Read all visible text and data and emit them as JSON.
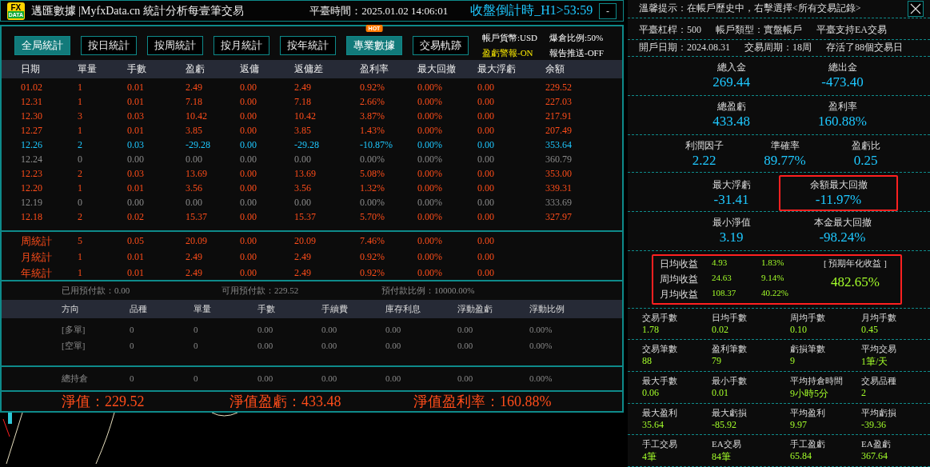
{
  "header": {
    "logo": [
      "FX",
      "DATA"
    ],
    "title": "邁匯數據 |MyfxData.cn 統計分析每壹筆交易",
    "time": "平臺時間：2025.01.02 14:06:01",
    "countdown": "收盤倒計時_H1>53:59",
    "minimize": "-"
  },
  "tabs": [
    {
      "label": "全局統計",
      "selected": true
    },
    {
      "label": "按日統計",
      "selected": false
    },
    {
      "label": "按周統計",
      "selected": false
    },
    {
      "label": "按月統計",
      "selected": false
    },
    {
      "label": "按年統計",
      "selected": false
    },
    {
      "label": "專業數據",
      "selected": true,
      "badge": "HOT"
    },
    {
      "label": "交易軌跡",
      "selected": false
    }
  ],
  "account_info": [
    {
      "text": "帳戶貨幣:USD",
      "kind": "plain"
    },
    {
      "text": "爆倉比例:50%",
      "kind": "plain"
    },
    {
      "text": "盈虧警報-ON",
      "kind": "alert"
    },
    {
      "text": "報告推送-OFF",
      "kind": "plain"
    }
  ],
  "table": {
    "columns": [
      "日期",
      "單量",
      "手數",
      "盈虧",
      "返傭",
      "返傭差",
      "盈利率",
      "最大回撤",
      "最大浮虧",
      "余額"
    ],
    "rows": [
      {
        "color": "#ff4d1a",
        "cells": [
          "01.02",
          "1",
          "0.01",
          "2.49",
          "0.00",
          "2.49",
          "0.92%",
          "0.00%",
          "0.00",
          "229.52"
        ]
      },
      {
        "color": "#ff4d1a",
        "cells": [
          "12.31",
          "1",
          "0.01",
          "7.18",
          "0.00",
          "7.18",
          "2.66%",
          "0.00%",
          "0.00",
          "227.03"
        ]
      },
      {
        "color": "#ff4d1a",
        "cells": [
          "12.30",
          "3",
          "0.03",
          "10.42",
          "0.00",
          "10.42",
          "3.87%",
          "0.00%",
          "0.00",
          "217.91"
        ]
      },
      {
        "color": "#ff4d1a",
        "cells": [
          "12.27",
          "1",
          "0.01",
          "3.85",
          "0.00",
          "3.85",
          "1.43%",
          "0.00%",
          "0.00",
          "207.49"
        ]
      },
      {
        "color": "#1ec8ff",
        "cells": [
          "12.26",
          "2",
          "0.03",
          "-29.28",
          "0.00",
          "-29.28",
          "-10.87%",
          "0.00%",
          "0.00",
          "353.64"
        ]
      },
      {
        "color": "#8a8a8a",
        "cells": [
          "12.24",
          "0",
          "0.00",
          "0.00",
          "0.00",
          "0.00",
          "0.00%",
          "0.00%",
          "0.00",
          "360.79"
        ]
      },
      {
        "color": "#ff4d1a",
        "cells": [
          "12.23",
          "2",
          "0.03",
          "13.69",
          "0.00",
          "13.69",
          "5.08%",
          "0.00%",
          "0.00",
          "353.00"
        ]
      },
      {
        "color": "#ff4d1a",
        "cells": [
          "12.20",
          "1",
          "0.01",
          "3.56",
          "0.00",
          "3.56",
          "1.32%",
          "0.00%",
          "0.00",
          "339.31"
        ]
      },
      {
        "color": "#8a8a8a",
        "cells": [
          "12.19",
          "0",
          "0.00",
          "0.00",
          "0.00",
          "0.00",
          "0.00%",
          "0.00%",
          "0.00",
          "333.69"
        ]
      },
      {
        "color": "#ff4d1a",
        "cells": [
          "12.18",
          "2",
          "0.02",
          "15.37",
          "0.00",
          "15.37",
          "5.70%",
          "0.00%",
          "0.00",
          "327.97"
        ]
      }
    ],
    "summary": [
      [
        "周統計",
        "5",
        "0.05",
        "20.09",
        "0.00",
        "20.09",
        "7.46%",
        "0.00%",
        "0.00"
      ],
      [
        "月統計",
        "1",
        "0.01",
        "2.49",
        "0.00",
        "2.49",
        "0.92%",
        "0.00%",
        "0.00"
      ],
      [
        "年統計",
        "1",
        "0.01",
        "2.49",
        "0.00",
        "2.49",
        "0.92%",
        "0.00%",
        "0.00"
      ]
    ]
  },
  "prepaid": [
    "已用預付款：0.00",
    "可用預付款：229.52",
    "預付款比例：10000.00%"
  ],
  "positions": {
    "columns": [
      "方向",
      "品種",
      "單量",
      "手數",
      "手續費",
      "庫存利息",
      "浮動盈虧",
      "浮動比例"
    ],
    "rows": [
      [
        "[多單]",
        "0",
        "0",
        "0.00",
        "0.00",
        "0.00",
        "0.00",
        "0.00%"
      ],
      [
        "[空單]",
        "0",
        "0",
        "0.00",
        "0.00",
        "0.00",
        "0.00",
        "0.00%"
      ]
    ],
    "total": [
      "總持倉",
      "0",
      "0",
      "0.00",
      "0.00",
      "0.00",
      "0.00",
      "0.00%"
    ]
  },
  "equity": [
    "淨值：229.52",
    "淨值盈虧：433.48",
    "淨值盈利率：160.88%"
  ],
  "side": {
    "tip": "溫馨提示：在帳戶歷史中，右擊選擇<所有交易記錄>",
    "info": [
      [
        "平臺杠桿：500",
        "帳戶類型：實盤帳戶",
        "平臺支持EA交易"
      ],
      [
        "開戶日期：2024.08.31",
        "交易周期：18周",
        "存活了88個交易日"
      ]
    ],
    "stats": [
      {
        "items": [
          {
            "label": "總入金",
            "value": "269.44",
            "highlighted": false
          },
          {
            "label": "總出金",
            "value": "-473.40",
            "highlighted": false
          }
        ]
      },
      {
        "items": [
          {
            "label": "總盈虧",
            "value": "433.48",
            "highlighted": false
          },
          {
            "label": "盈利率",
            "value": "160.88%",
            "highlighted": false
          }
        ]
      },
      {
        "items": [
          {
            "label": "利潤因子",
            "value": "2.22",
            "highlighted": false
          },
          {
            "label": "準確率",
            "value": "89.77%",
            "highlighted": false
          },
          {
            "label": "盈虧比",
            "value": "0.25",
            "highlighted": false
          }
        ]
      },
      {
        "items": [
          {
            "label": "最大浮虧",
            "value": "-31.41",
            "highlighted": false
          },
          {
            "label": "余額最大回撤",
            "value": "-11.97%",
            "highlighted": true
          }
        ]
      },
      {
        "items": [
          {
            "label": "最小淨值",
            "value": "3.19",
            "highlighted": false
          },
          {
            "label": "本金最大回撤",
            "value": "-98.24%",
            "highlighted": false
          }
        ]
      }
    ],
    "income": {
      "rows": [
        [
          "日均收益",
          "4.93",
          "1.83%"
        ],
        [
          "周均收益",
          "24.63",
          "9.14%"
        ],
        [
          "月均收益",
          "108.37",
          "40.22%"
        ]
      ],
      "title": "[ 預期年化收益 ]",
      "value": "482.65%"
    },
    "grid": [
      [
        {
          "label": "交易手數",
          "value": "1.78"
        },
        {
          "label": "日均手數",
          "value": "0.02"
        },
        {
          "label": "周均手數",
          "value": "0.10"
        },
        {
          "label": "月均手數",
          "value": "0.45"
        }
      ],
      [
        {
          "label": "交易筆數",
          "value": "88"
        },
        {
          "label": "盈利筆數",
          "value": "79"
        },
        {
          "label": "虧損筆數",
          "value": "9"
        },
        {
          "label": "平均交易",
          "value": "1筆/天"
        }
      ],
      [
        {
          "label": "最大手數",
          "value": "0.06"
        },
        {
          "label": "最小手數",
          "value": "0.01"
        },
        {
          "label": "平均持倉時間",
          "value": "9小時5分"
        },
        {
          "label": "交易品種",
          "value": "2"
        }
      ],
      [
        {
          "label": "最大盈利",
          "value": "35.64"
        },
        {
          "label": "最大虧損",
          "value": "-85.92"
        },
        {
          "label": "平均盈利",
          "value": "9.97"
        },
        {
          "label": "平均虧損",
          "value": "-39.36"
        }
      ],
      [
        {
          "label": "手工交易",
          "value": "4筆"
        },
        {
          "label": "EA交易",
          "value": "84筆"
        },
        {
          "label": "手工盈虧",
          "value": "65.84"
        },
        {
          "label": "EA盈虧",
          "value": "367.64"
        }
      ]
    ]
  }
}
